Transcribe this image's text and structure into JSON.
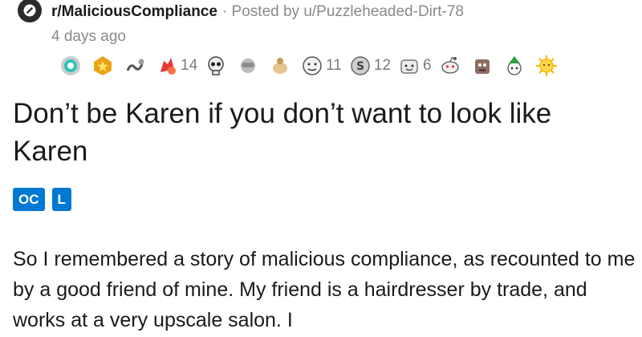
{
  "post": {
    "subreddit": "r/MaliciousCompliance",
    "posted_by": "· Posted by u/Puzzleheaded-Dirt-78",
    "time_ago": "4 days ago",
    "awards": [
      {
        "icon": "helpful-award-icon",
        "count": ""
      },
      {
        "icon": "gold-medal-award-icon",
        "count": ""
      },
      {
        "icon": "snek-award-icon",
        "count": ""
      },
      {
        "icon": "take-my-energy-award-icon",
        "count": "14"
      },
      {
        "icon": "skull-award-icon",
        "count": ""
      },
      {
        "icon": "facepalm-award-icon",
        "count": ""
      },
      {
        "icon": "bravo-award-icon",
        "count": ""
      },
      {
        "icon": "face-award-icon",
        "count": "11"
      },
      {
        "icon": "silver-coin-award-icon",
        "count": "12"
      },
      {
        "icon": "wholesome-award-icon",
        "count": "6"
      },
      {
        "icon": "snoo-award-icon",
        "count": ""
      },
      {
        "icon": "dog-award-icon",
        "count": ""
      },
      {
        "icon": "tree-hug-award-icon",
        "count": ""
      },
      {
        "icon": "sun-award-icon",
        "count": ""
      }
    ],
    "title": "Don’t be Karen if you don’t want to look like Karen",
    "flairs": [
      "OC",
      "L"
    ],
    "body": "So I remembered a story of malicious compliance, as recounted to me by a good friend of mine. My friend is a hairdresser by trade, and works at a very upscale salon. I"
  },
  "colors": {
    "flair_bg": "#0079d3",
    "meta_gray": "#878a8c",
    "text": "#1a1a1b"
  }
}
